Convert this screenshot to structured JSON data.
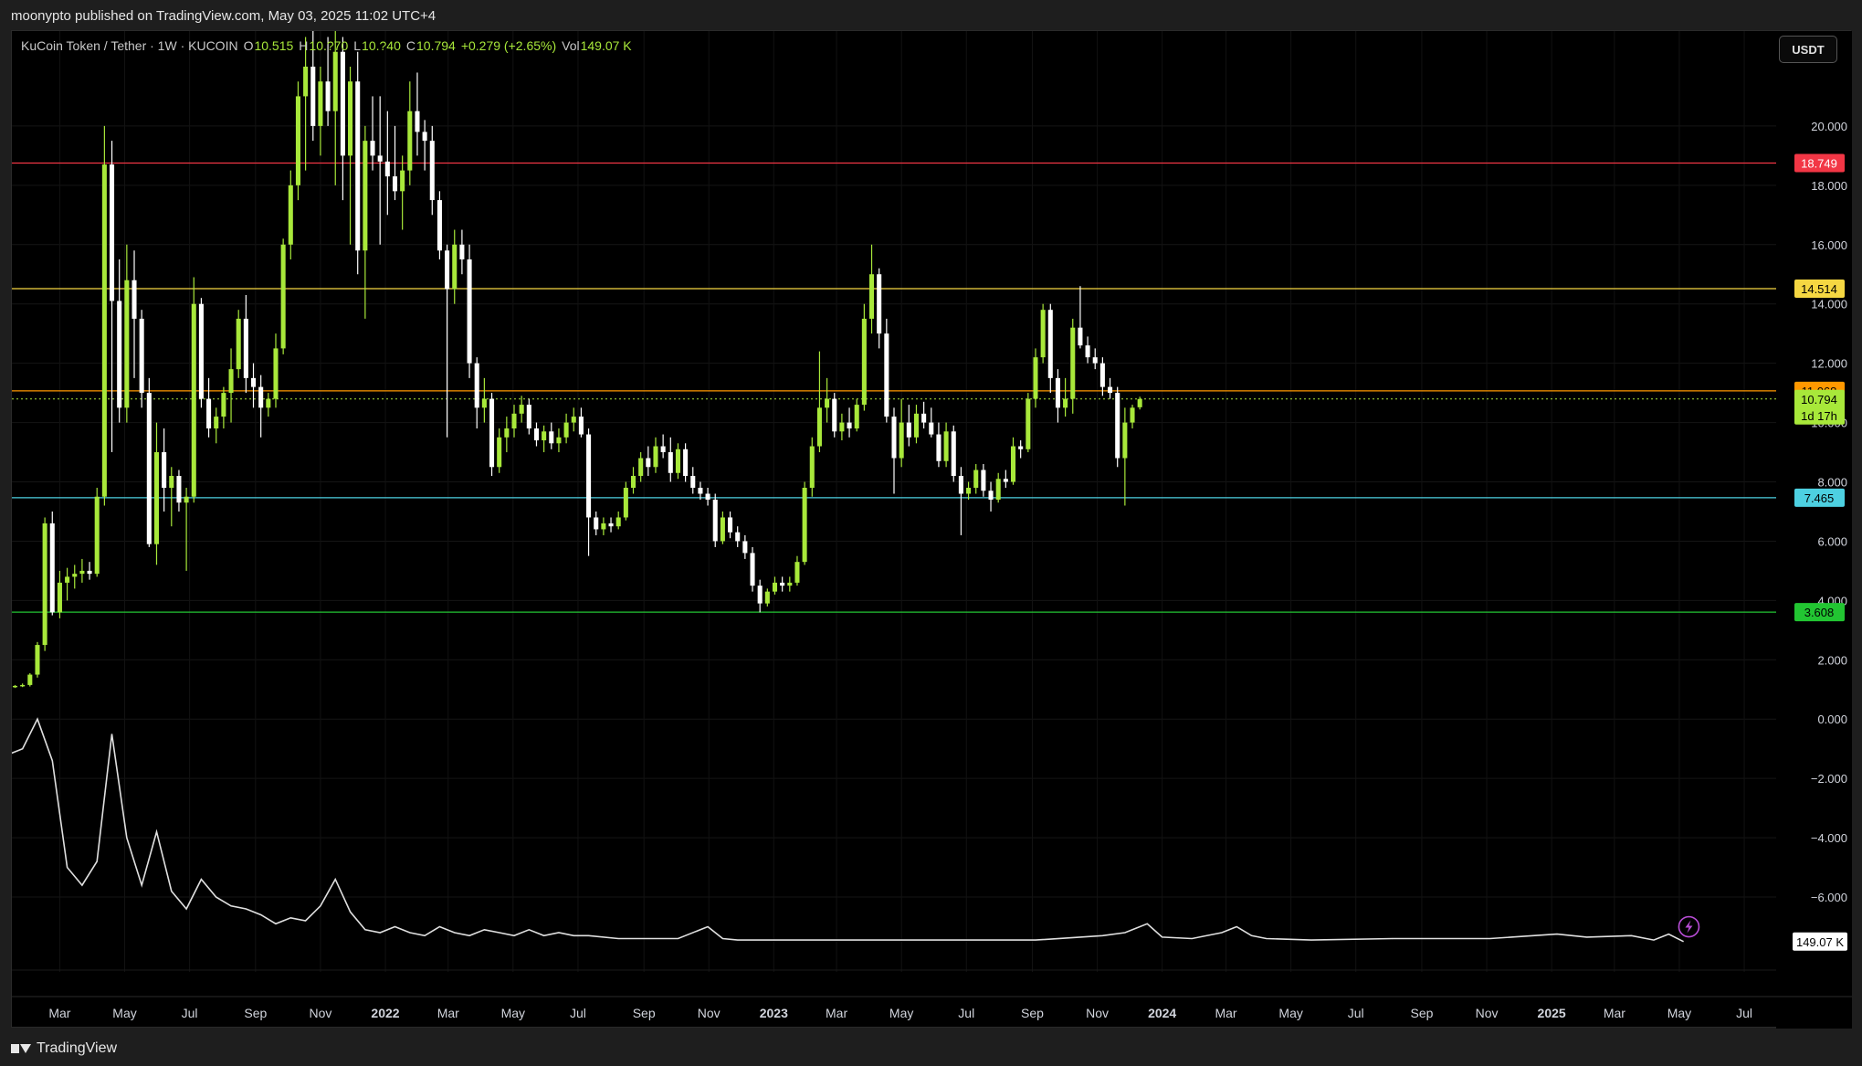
{
  "publisher_line": "moonypto published on TradingView.com, May 03, 2025 11:02 UTC+4",
  "legend": {
    "symbol": "KuCoin Token / Tether · 1W · KUCOIN",
    "open_label": "O",
    "open": "10.515",
    "high_label": "H",
    "high": "10.?70",
    "low_label": "L",
    "low": "10.?40",
    "close_label": "C",
    "close": "10.794",
    "change": "+0.279 (+2.65%)",
    "vol_label": "Vol",
    "vol": "149.07 K"
  },
  "currency_button": "USDT",
  "footer_brand": "TradingView",
  "colors": {
    "up": "#a8e83a",
    "down": "#ffffff",
    "level_red": "#f23645",
    "level_yellow": "#f5d742",
    "level_orange": "#ff9800",
    "level_cyan": "#4dd0e1",
    "level_green": "#22c532",
    "volume_line": "#e0e0e0"
  },
  "chart_data": {
    "type": "candlestick",
    "symbol": "KCS/USDT",
    "interval": "1W",
    "exchange": "KUCOIN",
    "x_range": [
      "2021-01-15",
      "2025-07-31"
    ],
    "y_range": [
      -7.6,
      23.2
    ],
    "y_ticks": [
      20,
      18,
      16,
      14,
      12,
      10,
      8,
      6,
      4,
      2,
      0,
      -2,
      -4,
      -6
    ],
    "y_tick_labels": [
      "20.000",
      "18.000",
      "16.000",
      "14.000",
      "12.000",
      "10.000",
      "8.000",
      "6.000",
      "4.000",
      "2.000",
      "0.000",
      "−2.000",
      "−4.000",
      "−6.000"
    ],
    "x_ticks": [
      {
        "label": "Mar",
        "date": "2021-03-01"
      },
      {
        "label": "May",
        "date": "2021-05-01"
      },
      {
        "label": "Jul",
        "date": "2021-07-01"
      },
      {
        "label": "Sep",
        "date": "2021-09-01"
      },
      {
        "label": "Nov",
        "date": "2021-11-01"
      },
      {
        "label": "2022",
        "date": "2022-01-01",
        "bold": true
      },
      {
        "label": "Mar",
        "date": "2022-03-01"
      },
      {
        "label": "May",
        "date": "2022-05-01"
      },
      {
        "label": "Jul",
        "date": "2022-07-01"
      },
      {
        "label": "Sep",
        "date": "2022-09-01"
      },
      {
        "label": "Nov",
        "date": "2022-11-01"
      },
      {
        "label": "2023",
        "date": "2023-01-01",
        "bold": true
      },
      {
        "label": "Mar",
        "date": "2023-03-01"
      },
      {
        "label": "May",
        "date": "2023-05-01"
      },
      {
        "label": "Jul",
        "date": "2023-07-01"
      },
      {
        "label": "Sep",
        "date": "2023-09-01"
      },
      {
        "label": "Nov",
        "date": "2023-11-01"
      },
      {
        "label": "2024",
        "date": "2024-01-01",
        "bold": true
      },
      {
        "label": "Mar",
        "date": "2024-03-01"
      },
      {
        "label": "May",
        "date": "2024-05-01"
      },
      {
        "label": "Jul",
        "date": "2024-07-01"
      },
      {
        "label": "Sep",
        "date": "2024-09-01"
      },
      {
        "label": "Nov",
        "date": "2024-11-01"
      },
      {
        "label": "2025",
        "date": "2025-01-01",
        "bold": true
      },
      {
        "label": "Mar",
        "date": "2025-03-01"
      },
      {
        "label": "May",
        "date": "2025-05-01"
      },
      {
        "label": "Jul",
        "date": "2025-07-01"
      }
    ],
    "horizontal_levels": [
      {
        "price": 18.749,
        "label": "18.749",
        "color": "#f23645"
      },
      {
        "price": 14.514,
        "label": "14.514",
        "color": "#f5d742"
      },
      {
        "price": 11.068,
        "label": "11.068",
        "color": "#ff9800"
      },
      {
        "price": 7.465,
        "label": "7.465",
        "color": "#4dd0e1"
      },
      {
        "price": 3.608,
        "label": "3.608",
        "color": "#22c532"
      }
    ],
    "last_price": {
      "price": 10.794,
      "label": "10.794",
      "countdown": "1d 17h"
    },
    "volume_label": "149.07 K",
    "candle_start": "2021-01-18",
    "candles": [
      [
        1.1,
        1.15,
        1.05,
        1.12
      ],
      [
        1.12,
        1.2,
        1.08,
        1.15
      ],
      [
        1.15,
        1.55,
        1.1,
        1.5
      ],
      [
        1.5,
        2.6,
        1.4,
        2.5
      ],
      [
        2.5,
        6.8,
        2.3,
        6.6
      ],
      [
        6.6,
        7.0,
        3.5,
        3.6
      ],
      [
        3.6,
        5.0,
        3.4,
        4.6
      ],
      [
        4.6,
        5.1,
        4.0,
        4.8
      ],
      [
        4.8,
        5.2,
        4.4,
        4.9
      ],
      [
        4.9,
        5.4,
        4.6,
        5.0
      ],
      [
        5.0,
        5.3,
        4.7,
        4.9
      ],
      [
        4.9,
        7.8,
        4.8,
        7.5
      ],
      [
        7.5,
        20.0,
        7.2,
        18.7
      ],
      [
        18.7,
        19.5,
        9.0,
        14.1
      ],
      [
        14.1,
        15.5,
        10.0,
        10.5
      ],
      [
        10.5,
        16.0,
        10.0,
        14.8
      ],
      [
        14.8,
        15.8,
        11.5,
        13.5
      ],
      [
        13.5,
        13.8,
        10.5,
        11.0
      ],
      [
        11.0,
        11.5,
        5.8,
        5.9
      ],
      [
        5.9,
        10.0,
        5.2,
        9.0
      ],
      [
        9.0,
        9.8,
        7.0,
        7.8
      ],
      [
        7.8,
        8.5,
        6.5,
        8.2
      ],
      [
        8.2,
        8.4,
        7.0,
        7.3
      ],
      [
        7.3,
        7.8,
        5.0,
        7.5
      ],
      [
        7.5,
        14.9,
        7.3,
        14.0
      ],
      [
        14.0,
        14.2,
        10.5,
        10.8
      ],
      [
        10.8,
        11.5,
        9.5,
        9.8
      ],
      [
        9.8,
        10.5,
        9.3,
        10.2
      ],
      [
        10.2,
        11.2,
        9.8,
        11.0
      ],
      [
        11.0,
        12.5,
        10.0,
        11.8
      ],
      [
        11.8,
        13.8,
        11.5,
        13.5
      ],
      [
        13.5,
        14.3,
        11.0,
        11.5
      ],
      [
        11.5,
        12.0,
        10.5,
        11.2
      ],
      [
        11.2,
        11.6,
        9.5,
        10.5
      ],
      [
        10.5,
        11.0,
        10.2,
        10.8
      ],
      [
        10.8,
        13.0,
        10.5,
        12.5
      ],
      [
        12.5,
        16.2,
        12.3,
        16.0
      ],
      [
        16.0,
        18.5,
        15.5,
        18.0
      ],
      [
        18.0,
        21.5,
        17.5,
        21.0
      ],
      [
        21.0,
        23.0,
        18.5,
        22.0
      ],
      [
        22.0,
        23.2,
        19.5,
        20.0
      ],
      [
        20.0,
        22.0,
        19.0,
        21.5
      ],
      [
        21.5,
        23.0,
        20.0,
        20.5
      ],
      [
        20.5,
        23.2,
        18.0,
        22.5
      ],
      [
        22.5,
        23.0,
        17.5,
        19.0
      ],
      [
        19.0,
        22.0,
        16.0,
        21.5
      ],
      [
        21.5,
        22.5,
        15.0,
        15.8
      ],
      [
        15.8,
        20.0,
        13.5,
        19.5
      ],
      [
        19.5,
        21.0,
        18.5,
        19.0
      ],
      [
        19.0,
        21.0,
        16.0,
        18.8
      ],
      [
        18.8,
        20.5,
        17.0,
        18.3
      ],
      [
        18.3,
        20.0,
        17.5,
        17.8
      ],
      [
        17.8,
        19.0,
        16.5,
        18.5
      ],
      [
        18.5,
        21.5,
        18.0,
        20.5
      ],
      [
        20.5,
        21.8,
        19.0,
        19.8
      ],
      [
        19.8,
        20.2,
        18.5,
        19.5
      ],
      [
        19.5,
        20.0,
        17.0,
        17.5
      ],
      [
        17.5,
        17.8,
        15.5,
        15.8
      ],
      [
        15.8,
        16.0,
        9.5,
        14.5
      ],
      [
        14.5,
        16.5,
        14.0,
        16.0
      ],
      [
        16.0,
        16.5,
        15.0,
        15.5
      ],
      [
        15.5,
        16.0,
        11.5,
        12.0
      ],
      [
        12.0,
        12.2,
        9.8,
        10.5
      ],
      [
        10.5,
        11.5,
        10.0,
        10.8
      ],
      [
        10.8,
        11.0,
        8.2,
        8.5
      ],
      [
        8.5,
        9.8,
        8.3,
        9.5
      ],
      [
        9.5,
        10.2,
        9.0,
        9.8
      ],
      [
        9.8,
        10.6,
        9.5,
        10.3
      ],
      [
        10.3,
        10.9,
        10.0,
        10.6
      ],
      [
        10.6,
        10.8,
        9.6,
        9.8
      ],
      [
        9.8,
        10.0,
        9.2,
        9.4
      ],
      [
        9.4,
        9.9,
        9.0,
        9.7
      ],
      [
        9.7,
        10.0,
        9.1,
        9.3
      ],
      [
        9.3,
        9.8,
        9.0,
        9.5
      ],
      [
        9.5,
        10.3,
        9.3,
        10.0
      ],
      [
        10.0,
        10.5,
        9.7,
        10.2
      ],
      [
        10.2,
        10.5,
        9.5,
        9.6
      ],
      [
        9.6,
        9.8,
        5.5,
        6.8
      ],
      [
        6.8,
        7.0,
        6.2,
        6.4
      ],
      [
        6.4,
        6.8,
        6.2,
        6.6
      ],
      [
        6.6,
        6.8,
        6.3,
        6.5
      ],
      [
        6.5,
        7.0,
        6.4,
        6.8
      ],
      [
        6.8,
        8.0,
        6.7,
        7.8
      ],
      [
        7.8,
        8.5,
        7.6,
        8.2
      ],
      [
        8.2,
        9.0,
        8.0,
        8.8
      ],
      [
        8.8,
        9.2,
        8.2,
        8.5
      ],
      [
        8.5,
        9.5,
        8.3,
        9.2
      ],
      [
        9.2,
        9.6,
        8.8,
        9.0
      ],
      [
        9.0,
        9.5,
        8.0,
        8.3
      ],
      [
        8.3,
        9.3,
        8.1,
        9.1
      ],
      [
        9.1,
        9.3,
        8.0,
        8.2
      ],
      [
        8.2,
        8.5,
        7.6,
        7.8
      ],
      [
        7.8,
        8.0,
        7.4,
        7.6
      ],
      [
        7.6,
        7.8,
        7.2,
        7.4
      ],
      [
        7.4,
        7.6,
        5.8,
        6.0
      ],
      [
        6.0,
        7.0,
        5.9,
        6.8
      ],
      [
        6.8,
        7.0,
        6.1,
        6.3
      ],
      [
        6.3,
        6.5,
        5.8,
        6.0
      ],
      [
        6.0,
        6.2,
        5.4,
        5.6
      ],
      [
        5.6,
        5.8,
        4.3,
        4.5
      ],
      [
        4.5,
        4.7,
        3.6,
        3.9
      ],
      [
        3.9,
        4.4,
        3.8,
        4.3
      ],
      [
        4.3,
        4.8,
        4.2,
        4.6
      ],
      [
        4.6,
        4.8,
        4.3,
        4.5
      ],
      [
        4.5,
        4.8,
        4.3,
        4.6
      ],
      [
        4.6,
        5.5,
        4.5,
        5.3
      ],
      [
        5.3,
        8.0,
        5.2,
        7.8
      ],
      [
        7.8,
        9.5,
        7.5,
        9.2
      ],
      [
        9.2,
        12.4,
        9.0,
        10.5
      ],
      [
        10.5,
        11.5,
        10.0,
        10.8
      ],
      [
        10.8,
        11.0,
        9.5,
        9.7
      ],
      [
        9.7,
        10.3,
        9.4,
        10.0
      ],
      [
        10.0,
        10.5,
        9.5,
        9.8
      ],
      [
        9.8,
        10.8,
        9.7,
        10.6
      ],
      [
        10.6,
        14.0,
        10.4,
        13.5
      ],
      [
        13.5,
        16.0,
        13.0,
        15.0
      ],
      [
        15.0,
        15.2,
        12.5,
        13.0
      ],
      [
        13.0,
        13.5,
        10.0,
        10.2
      ],
      [
        10.2,
        10.5,
        7.6,
        8.8
      ],
      [
        8.8,
        10.8,
        8.5,
        10.0
      ],
      [
        10.0,
        10.6,
        9.2,
        9.5
      ],
      [
        9.5,
        10.6,
        9.3,
        10.3
      ],
      [
        10.3,
        10.7,
        9.8,
        10.0
      ],
      [
        10.0,
        10.5,
        9.5,
        9.6
      ],
      [
        9.6,
        10.0,
        8.5,
        8.7
      ],
      [
        8.7,
        10.0,
        8.5,
        9.7
      ],
      [
        9.7,
        9.9,
        8.0,
        8.2
      ],
      [
        8.2,
        8.5,
        6.2,
        7.6
      ],
      [
        7.6,
        8.0,
        7.4,
        7.8
      ],
      [
        7.8,
        8.6,
        7.6,
        8.4
      ],
      [
        8.4,
        8.6,
        7.5,
        7.7
      ],
      [
        7.7,
        8.0,
        7.0,
        7.4
      ],
      [
        7.4,
        8.3,
        7.3,
        8.1
      ],
      [
        8.1,
        8.4,
        7.8,
        8.0
      ],
      [
        8.0,
        9.5,
        7.9,
        9.2
      ],
      [
        9.2,
        9.4,
        8.8,
        9.1
      ],
      [
        9.1,
        11.0,
        9.0,
        10.8
      ],
      [
        10.8,
        12.5,
        10.5,
        12.2
      ],
      [
        12.2,
        14.0,
        12.0,
        13.8
      ],
      [
        13.8,
        14.0,
        11.0,
        11.5
      ],
      [
        11.5,
        11.8,
        10.0,
        10.5
      ],
      [
        10.5,
        11.5,
        10.2,
        10.8
      ],
      [
        10.8,
        13.5,
        10.3,
        13.2
      ],
      [
        13.2,
        14.6,
        12.5,
        12.6
      ],
      [
        12.6,
        12.9,
        12.0,
        12.2
      ],
      [
        12.2,
        12.5,
        11.8,
        12.0
      ],
      [
        12.0,
        12.2,
        10.9,
        11.2
      ],
      [
        11.2,
        11.5,
        10.8,
        11.0
      ],
      [
        11.0,
        11.2,
        8.5,
        8.8
      ],
      [
        8.8,
        10.5,
        7.2,
        10.0
      ],
      [
        10.0,
        10.6,
        9.8,
        10.5
      ],
      [
        10.515,
        10.87,
        10.44,
        10.794
      ]
    ],
    "volume_line_x_date": [
      "2021-01-11",
      "2021-01-25",
      "2021-02-08",
      "2021-02-22",
      "2021-03-08",
      "2021-03-22",
      "2021-04-05",
      "2021-04-19",
      "2021-05-03",
      "2021-05-17",
      "2021-05-31",
      "2021-06-14",
      "2021-06-28",
      "2021-07-12",
      "2021-07-26",
      "2021-08-09",
      "2021-08-23",
      "2021-09-06",
      "2021-09-20",
      "2021-10-04",
      "2021-10-18",
      "2021-11-01",
      "2021-11-15",
      "2021-11-29",
      "2021-12-13",
      "2021-12-27",
      "2022-01-10",
      "2022-01-24",
      "2022-02-07",
      "2022-02-21",
      "2022-03-07",
      "2022-03-21",
      "2022-04-04",
      "2022-04-18",
      "2022-05-02",
      "2022-05-16",
      "2022-05-30",
      "2022-06-13",
      "2022-06-27",
      "2022-07-11",
      "2022-08-08",
      "2022-09-05",
      "2022-10-03",
      "2022-10-31",
      "2022-11-14",
      "2022-11-28",
      "2023-01-09",
      "2023-03-06",
      "2023-05-01",
      "2023-07-03",
      "2023-09-04",
      "2023-11-06",
      "2023-11-27",
      "2023-12-18",
      "2024-01-01",
      "2024-01-29",
      "2024-02-26",
      "2024-03-11",
      "2024-03-25",
      "2024-04-08",
      "2024-05-20",
      "2024-08-05",
      "2024-11-04",
      "2025-01-06",
      "2025-02-03",
      "2025-03-17",
      "2025-04-07",
      "2025-04-21",
      "2025-05-05"
    ],
    "volume_line_y": [
      -1.2,
      -1.0,
      0.0,
      -1.4,
      -5.0,
      -5.6,
      -4.8,
      -0.5,
      -4.0,
      -5.6,
      -3.8,
      -5.8,
      -6.4,
      -5.4,
      -6.0,
      -6.3,
      -6.4,
      -6.6,
      -6.9,
      -6.7,
      -6.8,
      -6.3,
      -5.4,
      -6.5,
      -7.1,
      -7.2,
      -7.0,
      -7.2,
      -7.3,
      -7.0,
      -7.2,
      -7.3,
      -7.1,
      -7.2,
      -7.3,
      -7.1,
      -7.3,
      -7.2,
      -7.3,
      -7.3,
      -7.4,
      -7.4,
      -7.4,
      -7.0,
      -7.4,
      -7.45,
      -7.45,
      -7.45,
      -7.45,
      -7.45,
      -7.45,
      -7.3,
      -7.2,
      -6.9,
      -7.35,
      -7.4,
      -7.2,
      -7.0,
      -7.3,
      -7.4,
      -7.45,
      -7.4,
      -7.4,
      -7.25,
      -7.35,
      -7.3,
      -7.45,
      -7.25,
      -7.5
    ]
  }
}
